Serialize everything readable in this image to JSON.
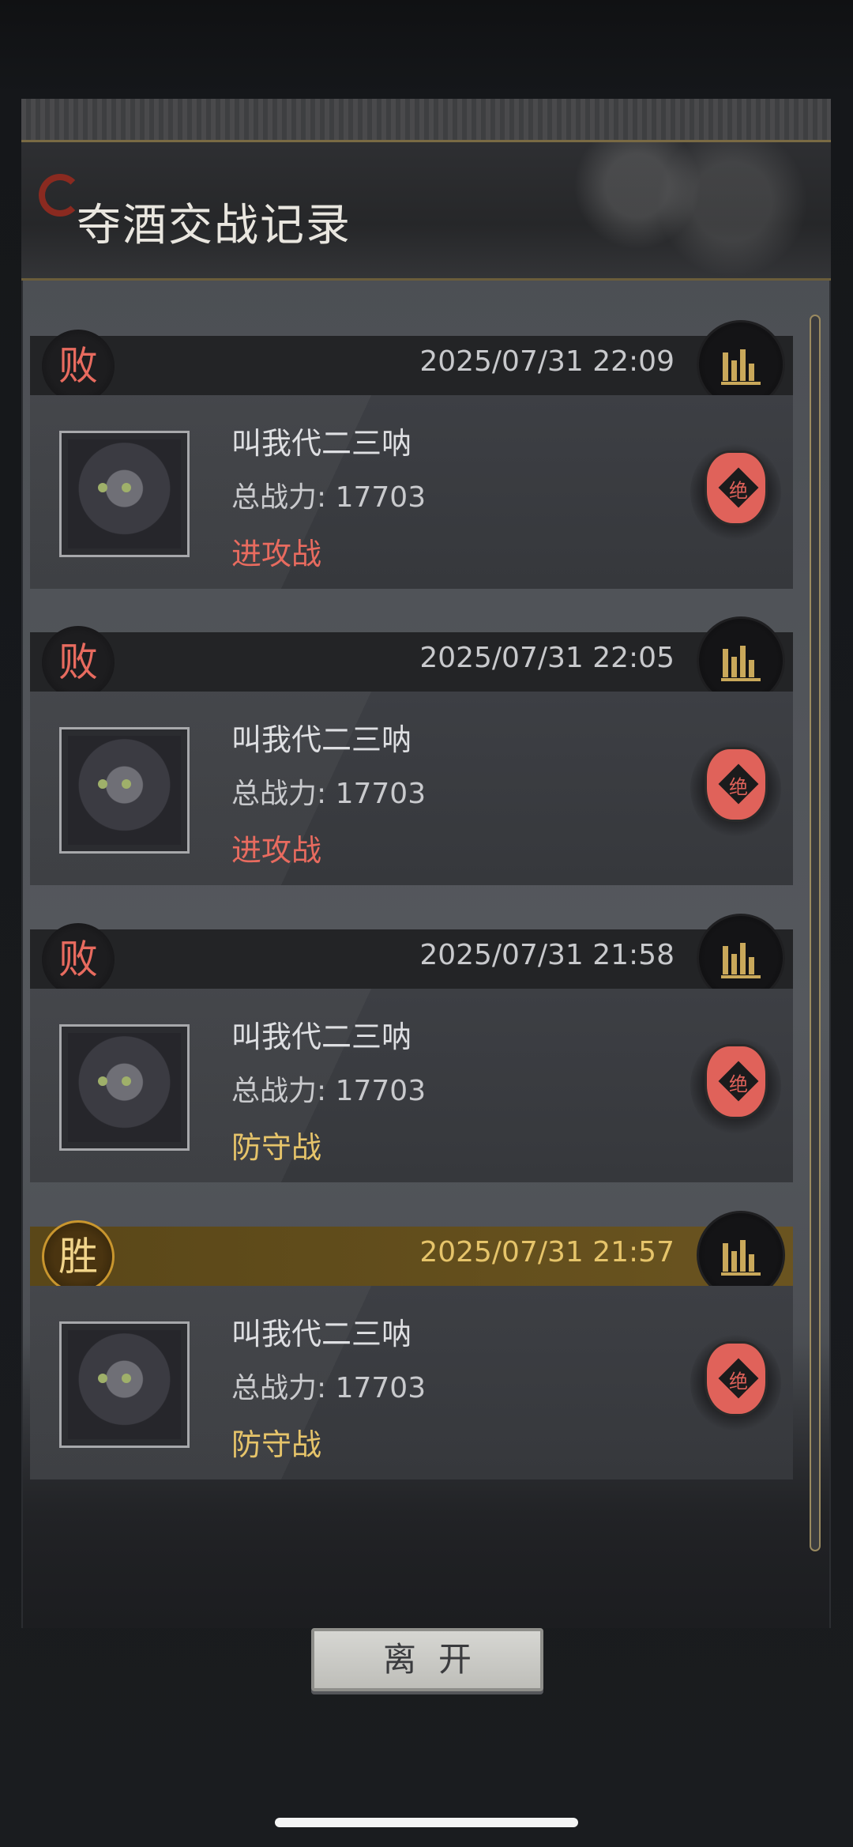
{
  "title": "夺酒交战记录",
  "records": [
    {
      "result": "败",
      "date": "2025/07/31 22:09",
      "name": "叫我代二三呐",
      "power": "总战力: 17703",
      "type": "进攻战",
      "jar_label": "绝"
    },
    {
      "result": "败",
      "date": "2025/07/31 22:05",
      "name": "叫我代二三呐",
      "power": "总战力: 17703",
      "type": "进攻战",
      "jar_label": "绝"
    },
    {
      "result": "败",
      "date": "2025/07/31 21:58",
      "name": "叫我代二三呐",
      "power": "总战力: 17703",
      "type": "防守战",
      "jar_label": "绝"
    },
    {
      "result": "胜",
      "date": "2025/07/31 21:57",
      "name": "叫我代二三呐",
      "power": "总战力: 17703",
      "type": "防守战",
      "jar_label": "绝"
    }
  ],
  "leave_label": "离开",
  "colors": {
    "loss": "#e86b5f",
    "win": "#e6c46a",
    "attack": "#e86b5f",
    "defense": "#e6c46a"
  },
  "icons": {
    "stats": "bar-chart-icon",
    "jar": "wine-jar-icon"
  }
}
